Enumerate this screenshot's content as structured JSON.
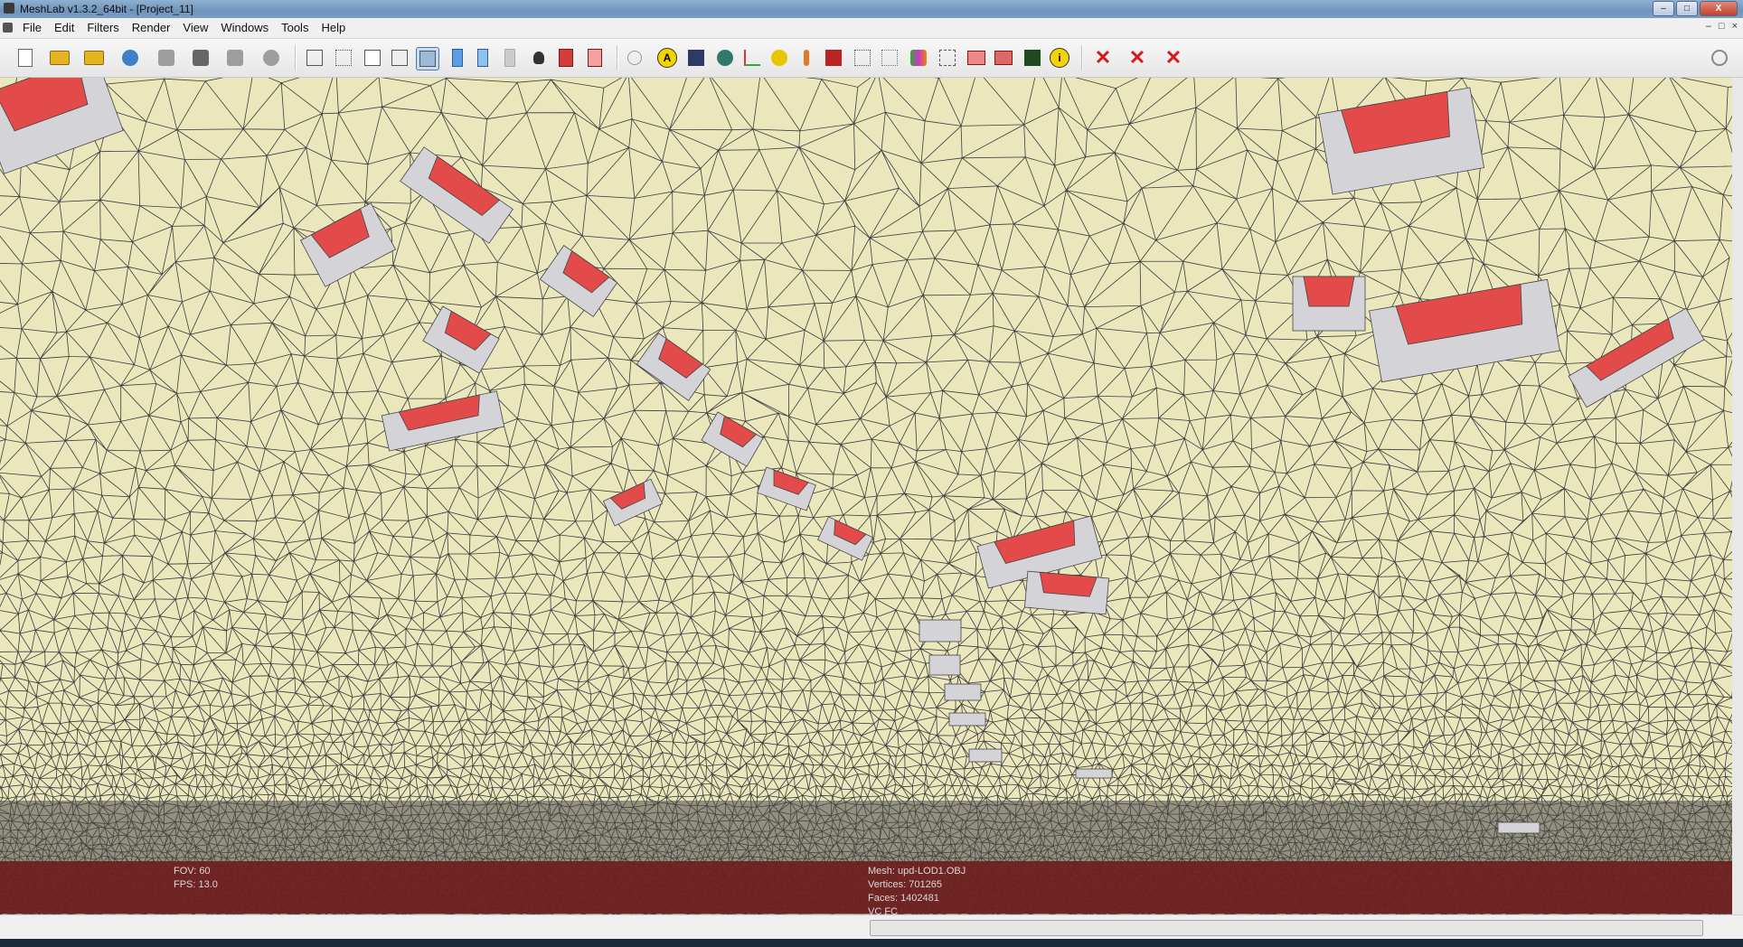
{
  "window": {
    "title": "MeshLab v1.3.2_64bit - [Project_11]",
    "controls": [
      "–",
      "□",
      "X"
    ]
  },
  "menu": {
    "items": [
      "File",
      "Edit",
      "Filters",
      "Render",
      "View",
      "Windows",
      "Tools",
      "Help"
    ],
    "mdi_controls": [
      "–",
      "□",
      "×"
    ]
  },
  "toolbar": {
    "attributes_label": "A",
    "info_label": "i"
  },
  "viewport": {
    "colors": {
      "ground": "#ebe7bd",
      "wire": "#3d3d3d",
      "roof": "#e34a4a",
      "wall": "#d4d4d8"
    }
  },
  "info": {
    "fov": "FOV: 60",
    "fps": "FPS:   13.0",
    "mesh": "Mesh: upd-LOD1.OBJ",
    "vertices": "Vertices: 701265",
    "faces": "Faces: 1402481",
    "mode": "VC FC"
  }
}
